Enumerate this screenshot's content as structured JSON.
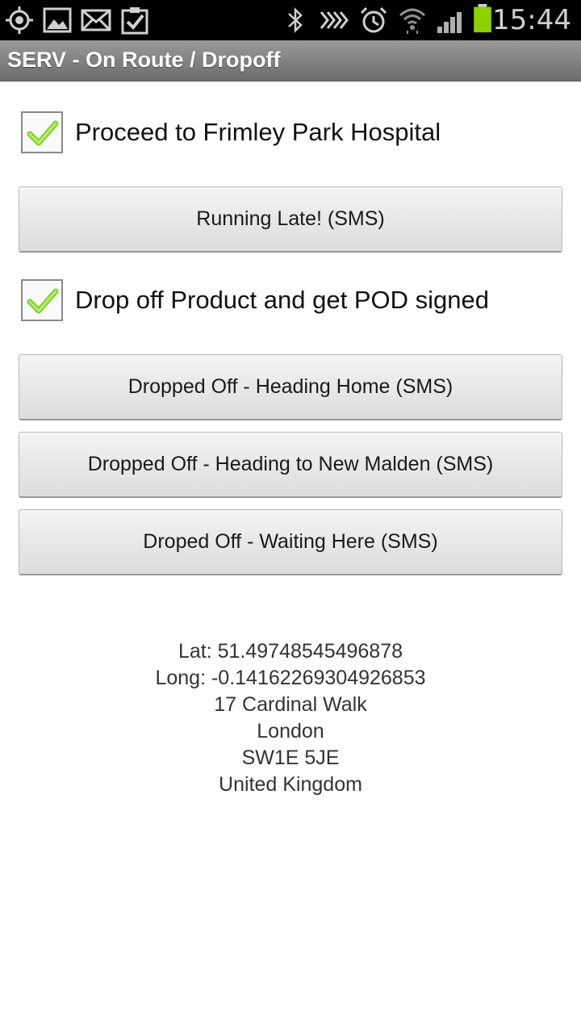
{
  "status_bar": {
    "time": "15:44",
    "left_icons": [
      "gps-icon",
      "gallery-icon",
      "mail-icon",
      "task-icon"
    ],
    "right_icons": [
      "bluetooth-icon",
      "nfc-icon",
      "alarm-icon",
      "wifi-icon",
      "signal-icon",
      "battery-icon"
    ],
    "battery_color": "#8cd100"
  },
  "app": {
    "title": "SERV - On Route / Dropoff"
  },
  "tasks": [
    {
      "label": "Proceed to Frimley Park Hospital",
      "checked": true
    },
    {
      "label": "Drop off Product and get POD signed",
      "checked": true
    }
  ],
  "buttons": {
    "running_late": "Running Late! (SMS)",
    "heading_home": "Dropped Off - Heading Home (SMS)",
    "heading_new_malden": "Dropped Off - Heading to New Malden (SMS)",
    "waiting_here": "Droped Off - Waiting Here (SMS)"
  },
  "location": {
    "lat": "Lat: 51.49748545496878",
    "long": "Long: -0.14162269304926853",
    "street": "17 Cardinal Walk",
    "city": "London",
    "postcode": "SW1E 5JE",
    "country": "United Kingdom"
  }
}
